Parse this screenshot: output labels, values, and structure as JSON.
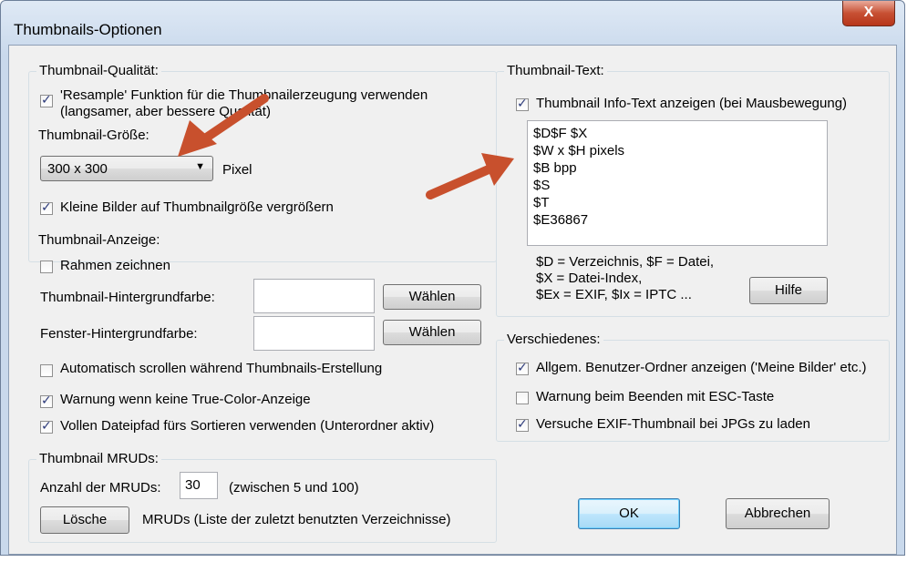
{
  "window": {
    "title": "Thumbnails-Optionen",
    "close_glyph": "X"
  },
  "quality": {
    "legend": "Thumbnail-Qualität:",
    "resample_line1": "'Resample' Funktion für die Thumbnailerzeugung verwenden",
    "resample_line2": "(langsamer, aber bessere Qualität)",
    "resample_checked": true
  },
  "size": {
    "legend": "Thumbnail-Größe:",
    "selected": "300 x 300",
    "unit": "Pixel",
    "enlarge_label": "Kleine Bilder auf Thumbnailgröße vergrößern",
    "enlarge_checked": true
  },
  "display": {
    "legend": "Thumbnail-Anzeige:",
    "frame_label": "Rahmen zeichnen",
    "frame_checked": false,
    "thumb_bg_label": "Thumbnail-Hintergrundfarbe:",
    "thumb_bg_button": "Wählen",
    "window_bg_label": "Fenster-Hintergrundfarbe:",
    "window_bg_button": "Wählen",
    "autoscroll_label": "Automatisch scrollen während Thumbnails-Erstellung",
    "autoscroll_checked": false,
    "truecolor_label": "Warnung wenn keine True-Color-Anzeige",
    "truecolor_checked": true,
    "fullpath_label": "Vollen Dateipfad fürs Sortieren verwenden (Unterordner aktiv)",
    "fullpath_checked": true
  },
  "mruds": {
    "legend": "Thumbnail MRUDs:",
    "count_label": "Anzahl der MRUDs:",
    "count_value": "30",
    "range_hint": "(zwischen 5 und 100)",
    "clear_button": "Lösche",
    "clear_desc": "MRUDs (Liste der zuletzt benutzten Verzeichnisse)"
  },
  "text": {
    "legend": "Thumbnail-Text:",
    "show_label": "Thumbnail Info-Text anzeigen (bei Mausbewegung)",
    "show_checked": true,
    "template_lines": [
      "$D$F $X",
      "$W x $H pixels",
      "$B bpp",
      "$S",
      "$T",
      "$E36867"
    ],
    "help_line1": "$D = Verzeichnis, $F = Datei,",
    "help_line2": "$X = Datei-Index,",
    "help_line3": "$Ex = EXIF, $Ix = IPTC ...",
    "help_button": "Hilfe"
  },
  "misc": {
    "legend": "Verschiedenes:",
    "userfolders_label": "Allgem. Benutzer-Ordner anzeigen ('Meine Bilder' etc.)",
    "userfolders_checked": true,
    "esc_label": "Warnung beim Beenden mit ESC-Taste",
    "esc_checked": false,
    "exif_label": "Versuche EXIF-Thumbnail bei JPGs zu laden",
    "exif_checked": true
  },
  "buttons": {
    "ok": "OK",
    "cancel": "Abbrechen"
  },
  "colors": {
    "annotation_arrow": "#c8502d"
  }
}
